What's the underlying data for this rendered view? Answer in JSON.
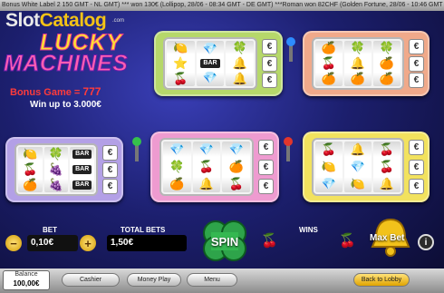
{
  "ticker": "Bonus White Label 2  150 GMT - NL GMT)  ***  won 130€ (Lollipop, 28/06 - 08:34 GMT - DE GMT)  ***Roman  won 82CHF (Golden Fortune, 28/06 - 10:46 GMT",
  "logo": {
    "part1": "Slot",
    "part2": "Catalog",
    "sub": ".com"
  },
  "title": {
    "line1": "LUCKY",
    "line2": "MACHINES"
  },
  "bonus": {
    "label": "Bonus Game = ",
    "value": "777"
  },
  "win_up_to": "Win up to 3.000€",
  "currency_symbol": "€",
  "machines": [
    {
      "color": "#b6d86a",
      "reels": [
        [
          "🍋",
          "⭐",
          "🍒"
        ],
        [
          "💎",
          "BAR",
          "💎"
        ],
        [
          "🍀",
          "🔔",
          "🔔"
        ]
      ]
    },
    {
      "color": "#f0a98a",
      "reels": [
        [
          "🍊",
          "🍒",
          "🍊"
        ],
        [
          "🍀",
          "🔔",
          "🍊"
        ],
        [
          "🍀",
          "🍊",
          "🍊"
        ]
      ]
    },
    {
      "color": "#b3a0e6",
      "reels": [
        [
          "🍋",
          "🍒",
          "🍊"
        ],
        [
          "🍀",
          "🍇",
          "🍇"
        ],
        [
          "BAR",
          "BAR",
          "BAR"
        ]
      ]
    },
    {
      "color": "#ee9bd0",
      "reels": [
        [
          "💎",
          "🍀",
          "🍊"
        ],
        [
          "💎",
          "🍒",
          "🔔"
        ],
        [
          "💎",
          "🍊",
          "🍒"
        ]
      ]
    },
    {
      "color": "#f2e25e",
      "reels": [
        [
          "🍒",
          "🍋",
          "💎"
        ],
        [
          "🔔",
          "💎",
          "🍋"
        ],
        [
          "🍒",
          "🍒",
          "🔔"
        ]
      ]
    }
  ],
  "bet": {
    "label": "BET",
    "value": "0,10€"
  },
  "total_bets": {
    "label": "TOTAL BETS",
    "value": "1,50€"
  },
  "spin_label": "SPIN",
  "wins": {
    "label": "WINS",
    "value": ""
  },
  "max_bet_label": "Max Bet",
  "info_label": "i",
  "balance": {
    "label": "Balance",
    "value": "100,00€"
  },
  "footer_buttons": {
    "cashier": "Cashier",
    "money_play": "Money Play",
    "menu": "Menu",
    "back_to_lobby": "Back to Lobby"
  },
  "icons": {
    "minus": "minus-icon",
    "plus": "plus-icon",
    "clover": "clover-icon",
    "cherry": "cherry-icon",
    "bell": "bell-icon",
    "info": "info-icon"
  }
}
